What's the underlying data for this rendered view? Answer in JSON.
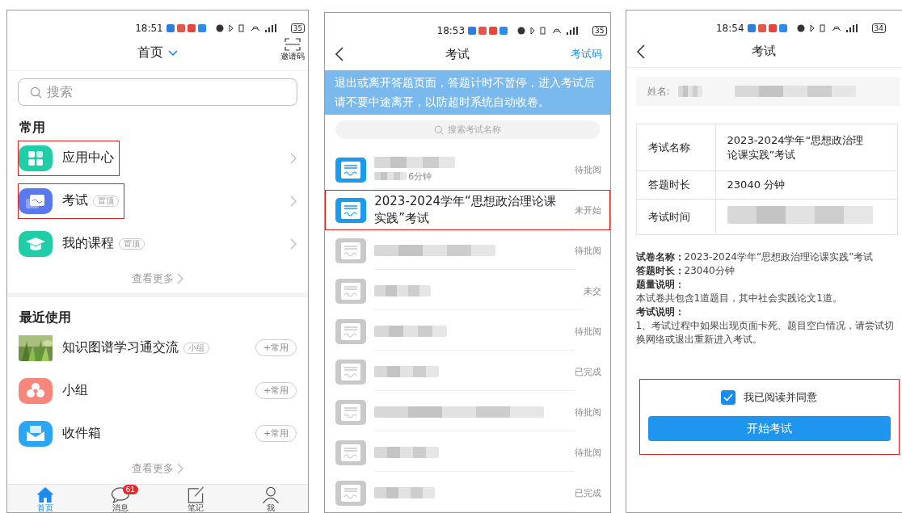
{
  "home_screen": {
    "status_bar": {
      "time": "18:51",
      "battery": "35"
    },
    "header": {
      "title": "首页",
      "invite_label": "邀请码"
    },
    "search": {
      "placeholder": "搜索"
    },
    "frequent": {
      "heading": "常用",
      "items": [
        {
          "label": "应用中心",
          "highlighted": true
        },
        {
          "label": "考试",
          "tag": "置顶",
          "highlighted": true
        },
        {
          "label": "我的课程",
          "tag": "置顶",
          "highlighted": false
        }
      ],
      "more": "查看更多"
    },
    "recent": {
      "heading": "最近使用",
      "items": [
        {
          "label": "知识图谱学习通交流",
          "tag": "小组",
          "action": "+常用"
        },
        {
          "label": "小组",
          "action": "+常用"
        },
        {
          "label": "收件箱",
          "action": "+常用"
        }
      ],
      "more": "查看更多"
    },
    "tab_bar": [
      {
        "label": "首页",
        "selected": true
      },
      {
        "label": "消息",
        "selected": false,
        "badge": "61"
      },
      {
        "label": "笔记",
        "selected": false
      },
      {
        "label": "我",
        "selected": false
      }
    ]
  },
  "exam_list_screen": {
    "status_bar": {
      "time": "18:53",
      "battery": "35"
    },
    "header": {
      "title": "考试",
      "action": "考试码"
    },
    "notice": "退出或离开答题页面，答题计时不暂停，进入考试后请不要中途离开，以防超时系统自动收卷。",
    "search": {
      "placeholder": "搜索考试名称"
    },
    "exams": [
      {
        "subtitle": "6分钟",
        "status": "待批阅",
        "active": true,
        "highlighted": false
      },
      {
        "title": "2023-2024学年“思想政治理论课实践”考试",
        "status": "未开始",
        "active": true,
        "highlighted": true
      },
      {
        "status": "待批阅",
        "active": false,
        "highlighted": false
      },
      {
        "status": "未交",
        "active": false,
        "highlighted": false
      },
      {
        "status": "待批阅",
        "active": false,
        "highlighted": false
      },
      {
        "status": "已完成",
        "active": false,
        "highlighted": false
      },
      {
        "status": "待批阅",
        "active": false,
        "highlighted": false
      },
      {
        "status": "待批阅",
        "active": false,
        "highlighted": false
      },
      {
        "status": "已完成",
        "active": false,
        "highlighted": false
      }
    ]
  },
  "exam_detail_screen": {
    "status_bar": {
      "time": "18:54",
      "battery": "34"
    },
    "header": {
      "title": "考试"
    },
    "name_label": "姓名:",
    "info_table": [
      {
        "label": "考试名称",
        "value": "2023-2024学年“思想政治理论课实践”考试"
      },
      {
        "label": "答题时长",
        "value": "23040 分钟"
      },
      {
        "label": "考试时间"
      }
    ],
    "notes": [
      {
        "kind": "text",
        "text": "**试卷名称：**2023-2024学年“思想政治理论课实践”考试"
      },
      {
        "kind": "text",
        "text": "**答题时长：**23040分钟"
      },
      {
        "kind": "heading",
        "text": "题量说明："
      },
      {
        "kind": "text",
        "text": "本试卷共包含1道题目，其中社会实践论文1道。"
      },
      {
        "kind": "heading",
        "text": "考试说明："
      },
      {
        "kind": "text",
        "text": "1、考试过程中如果出现页面卡死、题目空白情况，请尝试切换网络或退出重新进入考试。"
      }
    ],
    "agreement": {
      "label": "我已阅读并同意",
      "checked": true,
      "highlighted": true
    },
    "start_button": "开始考试"
  }
}
